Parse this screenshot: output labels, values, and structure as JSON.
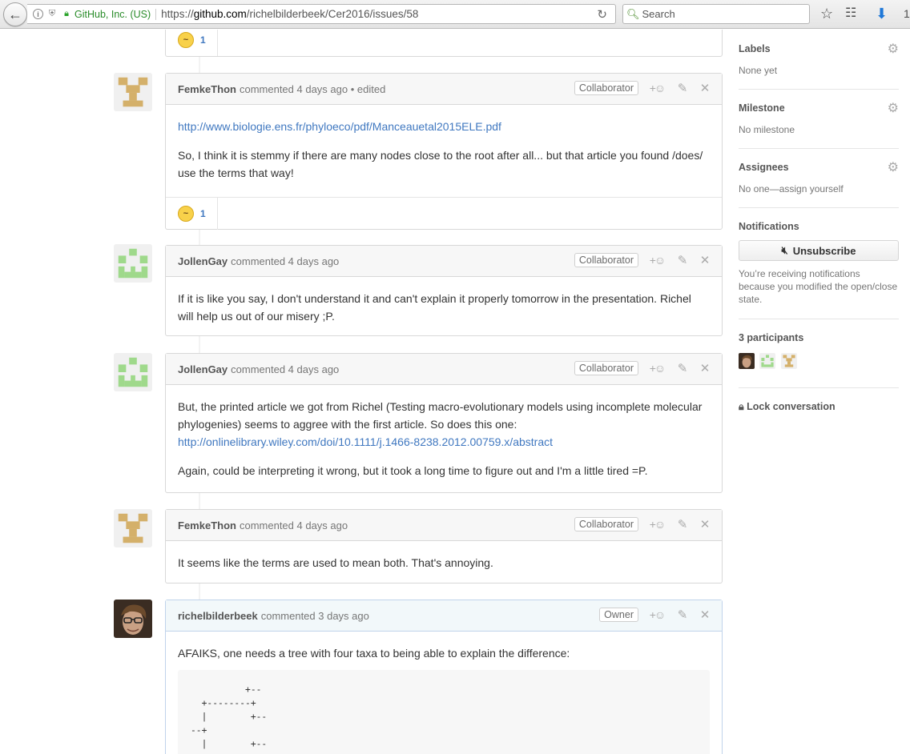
{
  "browser": {
    "site_identity": "GitHub, Inc. (US)",
    "url_prefix": "https://",
    "url_domain": "github.com",
    "url_path": "/richelbilderbeek/Cer2016/issues/58",
    "search_placeholder": "Search"
  },
  "prev_comment": {
    "reaction_count": "1"
  },
  "comments": [
    {
      "author": "FemkeThon",
      "meta": "commented 4 days ago • edited",
      "role": "Collaborator",
      "link": "http://www.biologie.ens.fr/phyloeco/pdf/Manceauetal2015ELE.pdf",
      "paragraph": "So, I think it is stemmy if there are many nodes close to the root after all... but that article you found /does/ use the terms that way!",
      "reaction_count": "1"
    },
    {
      "author": "JollenGay",
      "meta": "commented 4 days ago",
      "role": "Collaborator",
      "paragraph": "If it is like you say, I don't understand it and can't explain it properly tomorrow in the presentation. Richel will help us out of our misery ;P."
    },
    {
      "author": "JollenGay",
      "meta": "commented 4 days ago",
      "role": "Collaborator",
      "paragraph": "But, the printed article we got from Richel (Testing macro-evolutionary models using incomplete molecular phylogenies) seems to aggree with the first article. So does this one:",
      "link": "http://onlinelibrary.wiley.com/doi/10.1111/j.1466-8238.2012.00759.x/abstract",
      "paragraph2": "Again, could be interpreting it wrong, but it took a long time to figure out and I'm a little tired =P."
    },
    {
      "author": "FemkeThon",
      "meta": "commented 4 days ago",
      "role": "Collaborator",
      "paragraph": "It seems like the terms are used to mean both. That's annoying."
    },
    {
      "author": "richelbilderbeek",
      "meta": "commented 3 days ago",
      "role": "Owner",
      "paragraph": "AFAIKS, one needs a tree with four taxa to being able to explain the difference:",
      "code": "          +--\n  +--------+\n  |        +--\n--+\n  |        +--"
    }
  ],
  "sidebar": {
    "labels_title": "Labels",
    "labels_value": "None yet",
    "milestone_title": "Milestone",
    "milestone_value": "No milestone",
    "assignees_title": "Assignees",
    "assignees_value": "No one—assign yourself",
    "notifications_title": "Notifications",
    "unsubscribe_label": "Unsubscribe",
    "notifications_text": "You’re receiving notifications because you modified the open/close state.",
    "participants_title": "3 participants",
    "lock_label": "Lock conversation"
  },
  "colors": {
    "link": "#4078c0",
    "identicon_femke": "#d4b06a",
    "identicon_jollen": "#9fd98b",
    "owner_header": "#f2f8fa"
  }
}
